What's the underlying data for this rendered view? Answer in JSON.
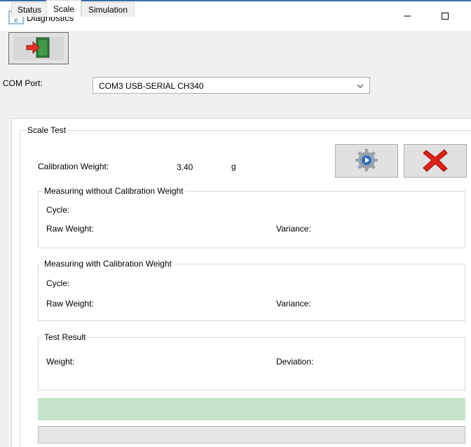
{
  "window": {
    "title": "Diagnostics",
    "app_icon": "rain-e-logo",
    "minimize_icon": "minimize-icon",
    "maximize_icon": "maximize-icon"
  },
  "toolbar": {
    "exit_icon": "exit-door-icon"
  },
  "com_port": {
    "label": "COM Port:",
    "value": "COM3  USB-SERIAL CH340"
  },
  "tabs": [
    {
      "label": "Status",
      "active": false
    },
    {
      "label": "Scale",
      "active": true
    },
    {
      "label": "Simulation",
      "active": false
    }
  ],
  "scale_test": {
    "title": "Scale Test",
    "calibration_label": "Calibration Weight:",
    "calibration_value": "3.40",
    "calibration_unit": "g",
    "run_icon": "gear-play-icon",
    "cancel_icon": "red-x-icon",
    "without": {
      "title": "Measuring without Calibration Weight",
      "cycle_label": "Cycle:",
      "raw_label": "Raw Weight:",
      "variance_label": "Variance:"
    },
    "with": {
      "title": "Measuring with Calibration Weight",
      "cycle_label": "Cycle:",
      "raw_label": "Raw Weight:",
      "variance_label": "Variance:"
    },
    "result": {
      "title": "Test Result",
      "weight_label": "Weight:",
      "deviation_label": "Deviation:"
    }
  },
  "colors": {
    "status_bar": "#c4e3c8",
    "window_accent": "#3a6ea5"
  }
}
